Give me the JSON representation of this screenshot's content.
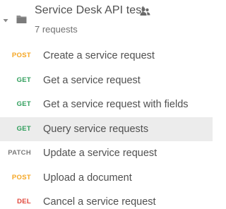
{
  "collection": {
    "name": "Service Desk API test",
    "count_label": "7 requests",
    "folder_icon": "folder-icon",
    "shared_icon": "team-icon",
    "expanded": true
  },
  "requests": [
    {
      "method": "POST",
      "method_color": "#f5a623",
      "name": "Create a service request",
      "selected": false
    },
    {
      "method": "GET",
      "method_color": "#2f9e5b",
      "name": "Get a service request",
      "selected": false
    },
    {
      "method": "GET",
      "method_color": "#2f9e5b",
      "name": "Get a service request with fields",
      "selected": false
    },
    {
      "method": "GET",
      "method_color": "#2f9e5b",
      "name": "Query service requests",
      "selected": true
    },
    {
      "method": "PATCH",
      "method_color": "#7a7a7a",
      "name": "Update a service request",
      "selected": false
    },
    {
      "method": "POST",
      "method_color": "#f5a623",
      "name": "Upload a document",
      "selected": false
    },
    {
      "method": "DEL",
      "method_color": "#e0453a",
      "name": "Cancel a service request",
      "selected": false
    }
  ]
}
